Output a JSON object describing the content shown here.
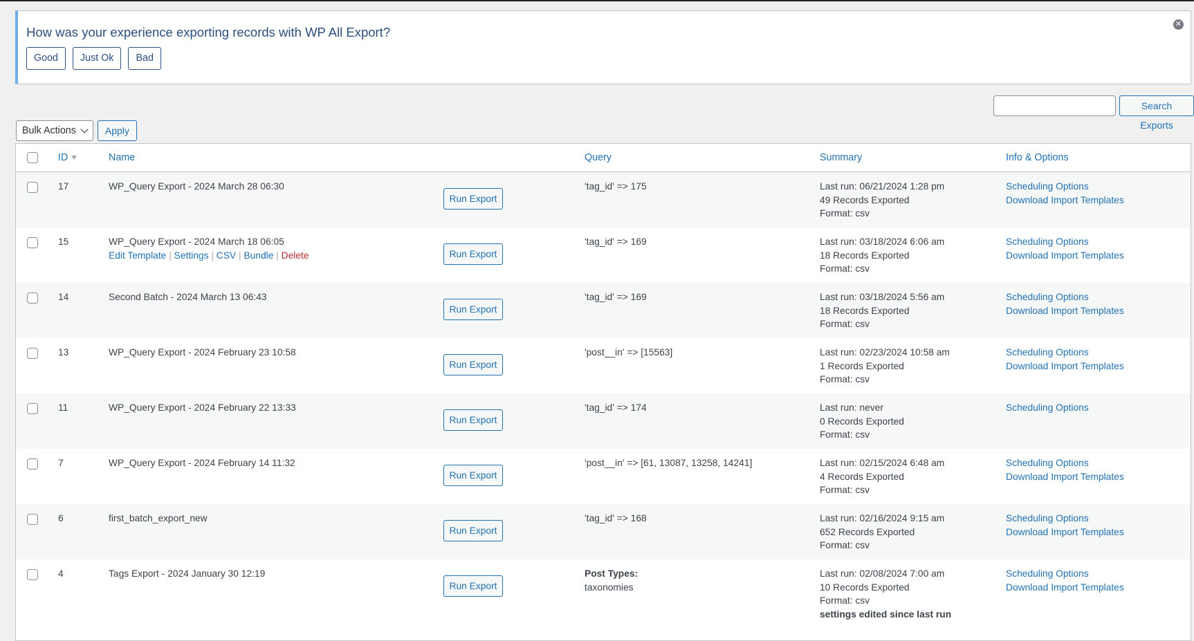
{
  "notice": {
    "question": "How was your experience exporting records with WP All Export?",
    "buttons": [
      "Good",
      "Just Ok",
      "Bad"
    ],
    "dismiss_icon": "close-circle-icon"
  },
  "search": {
    "value": "",
    "placeholder": "",
    "button_label": "Search Exports"
  },
  "bulk": {
    "selected": "Bulk Actions",
    "apply_label": "Apply"
  },
  "table": {
    "headers": {
      "id": "ID",
      "name": "Name",
      "query": "Query",
      "summary": "Summary",
      "info": "Info & Options"
    },
    "run_label": "Run Export",
    "row_actions": [
      "Edit Template",
      "Settings",
      "CSV",
      "Bundle",
      "Delete"
    ],
    "rows": [
      {
        "id": "17",
        "name": "WP_Query Export - 2024 March 28 06:30",
        "query": [
          "'tag_id' => 175"
        ],
        "summary": [
          "Last run: 06/21/2024 1:28 pm",
          "49 Records Exported",
          "Format: csv"
        ],
        "info": [
          "Scheduling Options",
          "Download Import Templates"
        ]
      },
      {
        "id": "15",
        "name": "WP_Query Export - 2024 March 18 06:05",
        "query": [
          "'tag_id' => 169"
        ],
        "summary": [
          "Last run: 03/18/2024 6:06 am",
          "18 Records Exported",
          "Format: csv"
        ],
        "info": [
          "Scheduling Options",
          "Download Import Templates"
        ],
        "show_actions": true
      },
      {
        "id": "14",
        "name": "Second Batch - 2024 March 13 06:43",
        "query": [
          "'tag_id' => 169"
        ],
        "summary": [
          "Last run: 03/18/2024 5:56 am",
          "18 Records Exported",
          "Format: csv"
        ],
        "info": [
          "Scheduling Options",
          "Download Import Templates"
        ]
      },
      {
        "id": "13",
        "name": "WP_Query Export - 2024 February 23 10:58",
        "query": [
          "'post__in' => [15563]"
        ],
        "summary": [
          "Last run: 02/23/2024 10:58 am",
          "1 Records Exported",
          "Format: csv"
        ],
        "info": [
          "Scheduling Options",
          "Download Import Templates"
        ]
      },
      {
        "id": "11",
        "name": "WP_Query Export - 2024 February 22 13:33",
        "query": [
          "'tag_id' => 174"
        ],
        "summary": [
          "Last run: never",
          "0 Records Exported",
          "Format: csv"
        ],
        "info": [
          "Scheduling Options"
        ]
      },
      {
        "id": "7",
        "name": "WP_Query Export - 2024 February 14 11:32",
        "query": [
          "'post__in' => [61, 13087, 13258, 14241]"
        ],
        "summary": [
          "Last run: 02/15/2024 6:48 am",
          "4 Records Exported",
          "Format: csv"
        ],
        "info": [
          "Scheduling Options",
          "Download Import Templates"
        ]
      },
      {
        "id": "6",
        "name": "first_batch_export_new",
        "query": [
          "'tag_id' => 168"
        ],
        "summary": [
          "Last run: 02/16/2024 9:15 am",
          "652 Records Exported",
          "Format: csv"
        ],
        "info": [
          "Scheduling Options",
          "Download Import Templates"
        ]
      },
      {
        "id": "4",
        "name": "Tags Export - 2024 January 30 12:19",
        "query_label": "Post Types:",
        "query": [
          "taxonomies"
        ],
        "summary": [
          "Last run: 02/08/2024 7:00 am",
          "10 Records Exported",
          "Format: csv"
        ],
        "summary_note": "settings edited since last run",
        "info": [
          "Scheduling Options",
          "Download Import Templates"
        ]
      }
    ]
  },
  "colors": {
    "link": "#2271b1",
    "notice_accent": "#72aee6",
    "delete": "#b32d2e",
    "notice_text": "#2c4f7f"
  }
}
